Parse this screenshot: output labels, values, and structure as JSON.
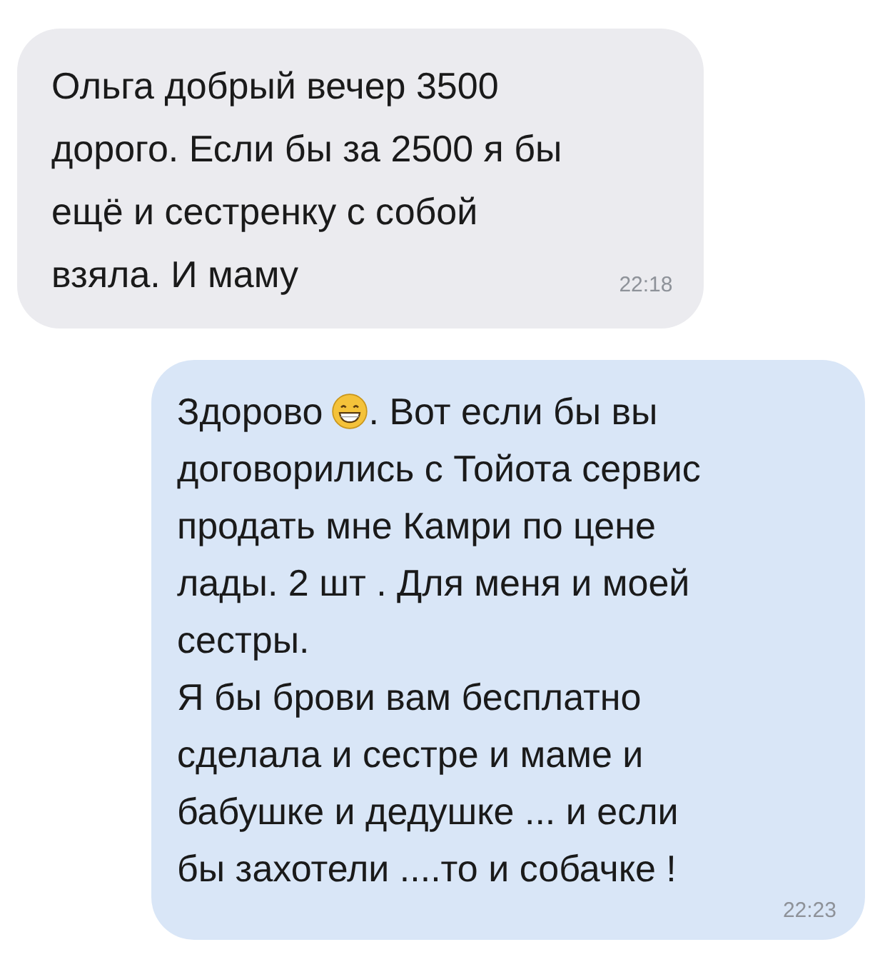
{
  "messages": [
    {
      "kind": "incoming",
      "parts": [
        {
          "kind": "block",
          "text": "Ольга добрый вечер 3500\nдорого. Если бы за 2500 я бы\nещё и сестренку с собой\nвзяла. И маму"
        }
      ],
      "time": "22:18"
    },
    {
      "kind": "outgoing",
      "parts": [
        {
          "kind": "inline",
          "text": "Здорово"
        },
        {
          "kind": "emoji"
        },
        {
          "kind": "inline",
          "text": ". Вот если бы вы"
        },
        {
          "kind": "block",
          "text": "договорились с Тойота сервис\nпродать мне Камри по цене\nлады. 2 шт . Для меня и моей\nсестры.\nЯ бы брови вам бесплатно\nсделала и сестре и маме и\nбабушке и дедушке ... и если\nбы захотели ....то и собачке !"
        }
      ],
      "time": "22:23"
    }
  ]
}
